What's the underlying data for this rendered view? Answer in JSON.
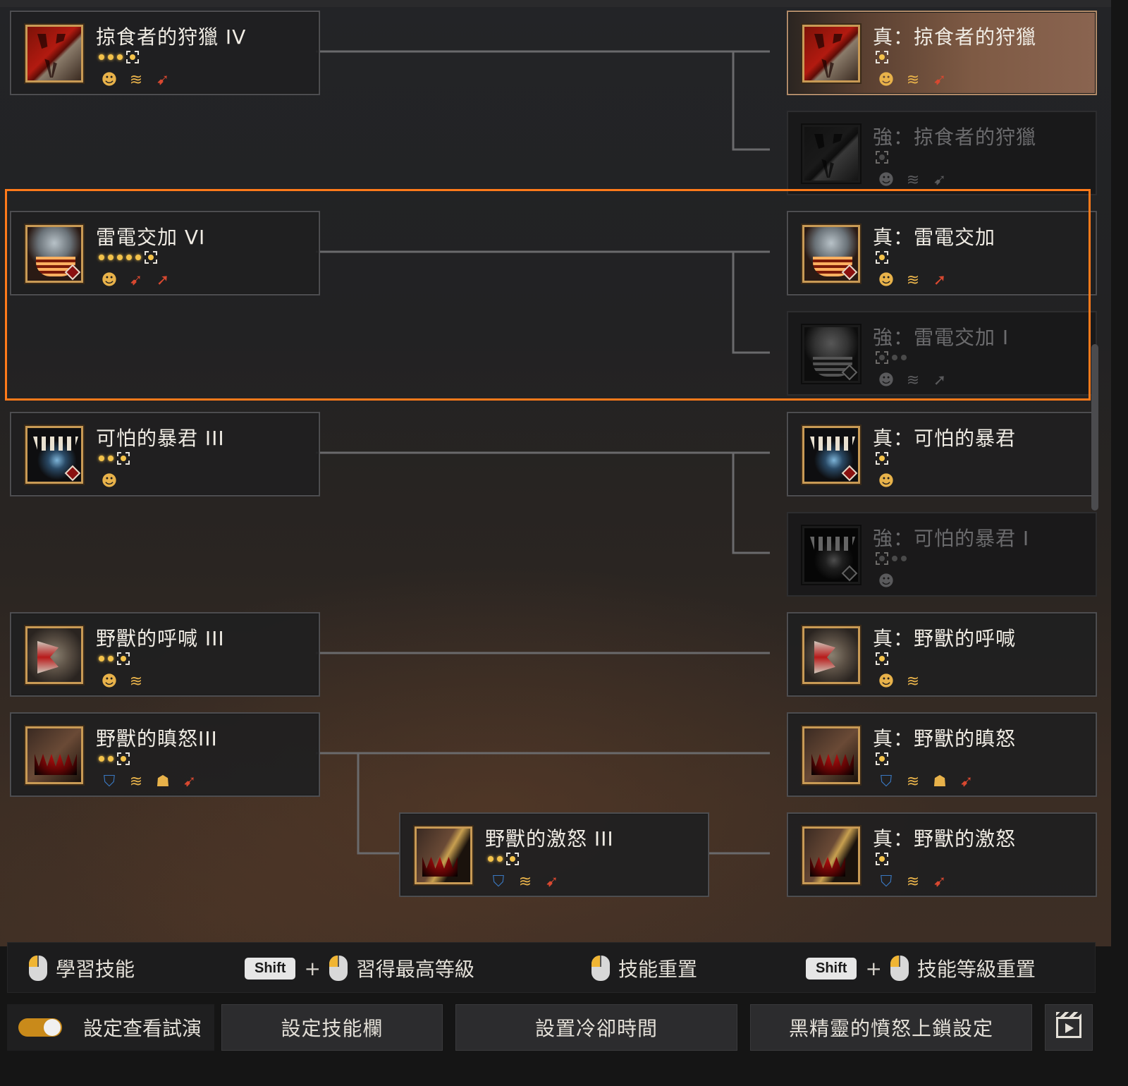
{
  "skills": [
    {
      "id": "predator",
      "base": {
        "name": "掠食者的狩獵 IV",
        "dots": 3,
        "tags": [
          "head",
          "move",
          "dash"
        ],
        "art": "claw",
        "diamond": false
      },
      "upgrades": [
        {
          "name": "真：掠食者的狩獵",
          "state": "selected",
          "tags": [
            "head",
            "move",
            "dash"
          ]
        },
        {
          "name": "強：掠食者的狩獵",
          "state": "locked",
          "tags": [
            "head",
            "move",
            "dash"
          ]
        }
      ]
    },
    {
      "id": "thunder",
      "base": {
        "name": "雷電交加 VI",
        "dots": 5,
        "tags": [
          "head",
          "dash",
          "arrow"
        ],
        "art": "thunder",
        "diamond": true
      },
      "upgrades": [
        {
          "name": "真：雷電交加",
          "state": "active",
          "tags": [
            "head",
            "move",
            "arrow"
          ]
        },
        {
          "name": "強：雷電交加 I",
          "state": "locked",
          "tags": [
            "head",
            "move",
            "arrow"
          ]
        }
      ]
    },
    {
      "id": "tyrant",
      "base": {
        "name": "可怕的暴君 III",
        "dots": 2,
        "tags": [
          "head"
        ],
        "art": "tyrant",
        "diamond": true
      },
      "upgrades": [
        {
          "name": "真：可怕的暴君",
          "state": "active",
          "tags": [
            "head"
          ]
        },
        {
          "name": "強：可怕的暴君 I",
          "state": "locked",
          "tags": [
            "head"
          ]
        }
      ]
    },
    {
      "id": "roar",
      "base": {
        "name": "野獸的呼喊 III",
        "dots": 2,
        "tags": [
          "head",
          "move"
        ],
        "art": "roar",
        "diamond": false
      },
      "upgrades": [
        {
          "name": "真：野獸的呼喊",
          "state": "active",
          "tags": [
            "head",
            "move"
          ]
        }
      ]
    },
    {
      "id": "rage",
      "base": {
        "name": "野獸的瞋怒III",
        "dots": 2,
        "tags": [
          "shield",
          "move",
          "people",
          "dash"
        ],
        "art": "rage",
        "diamond": false
      },
      "upgrades": [
        {
          "name": "真：野獸的瞋怒",
          "state": "active",
          "tags": [
            "shield",
            "move",
            "people",
            "dash"
          ]
        }
      ]
    },
    {
      "id": "fury",
      "base": {
        "name": "野獸的激怒 III",
        "dots": 2,
        "tags": [
          "shield",
          "move",
          "dash"
        ],
        "art": "fury",
        "diamond": false
      },
      "upgrades": [
        {
          "name": "真：野獸的激怒",
          "state": "active",
          "tags": [
            "shield",
            "move",
            "dash"
          ]
        }
      ]
    }
  ],
  "tag_glyphs": {
    "head": "☻",
    "move": "≋",
    "dash": "➹",
    "arrow": "➚",
    "shield": "⛉",
    "people": "☗"
  },
  "hints": [
    {
      "key": "",
      "label": "學習技能"
    },
    {
      "key": "Shift",
      "plus": "+",
      "label": "習得最高等級"
    },
    {
      "key": "",
      "label": "技能重置"
    },
    {
      "key": "Shift",
      "plus": "+",
      "label": "技能等級重置"
    }
  ],
  "footer": {
    "toggle_label": "設定查看試演",
    "toggle_on": true,
    "btn_skillbar": "設定技能欄",
    "btn_cooldown": "設置冷卻時間",
    "btn_lock": "黑精靈的憤怒上鎖設定"
  },
  "colors": {
    "highlight": "#ff7a1a",
    "gold": "#c89a55",
    "dot": "#f3c24a",
    "toggle": "#c98a1a"
  }
}
